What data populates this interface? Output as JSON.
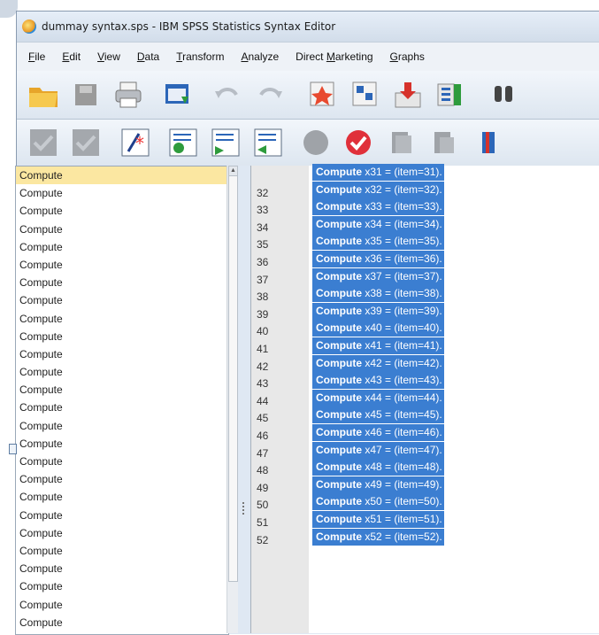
{
  "window": {
    "title": "dummay syntax.sps - IBM SPSS Statistics Syntax Editor"
  },
  "menu": [
    {
      "label": "File",
      "acc": "F",
      "rest": "ile"
    },
    {
      "label": "Edit",
      "acc": "E",
      "rest": "dit"
    },
    {
      "label": "View",
      "acc": "V",
      "rest": "iew"
    },
    {
      "label": "Data",
      "acc": "D",
      "rest": "ata"
    },
    {
      "label": "Transform",
      "acc": "T",
      "rest": "ransform"
    },
    {
      "label": "Analyze",
      "acc": "A",
      "rest": "nalyze"
    },
    {
      "label": "Direct Marketing",
      "pre": "Direct ",
      "acc": "M",
      "rest": "arketing"
    },
    {
      "label": "Graphs",
      "acc": "G",
      "rest": "raphs"
    }
  ],
  "toolbar1": [
    "open-folder-icon",
    "save-icon",
    "print-icon",
    "recall-dialog-icon",
    "undo-icon",
    "redo-icon",
    "goto-case-icon",
    "goto-variable-icon",
    "variables-icon",
    "run-descriptives-icon",
    "find-icon"
  ],
  "toolbar2": [
    "check-icon",
    "check-icon",
    "comment-icon",
    "run-icon",
    "run-to-end-icon",
    "run-selection-icon",
    "stop-icon",
    "validate-icon",
    "bookmark-icon",
    "bookmark-next-icon",
    "bookmark-previous-icon"
  ],
  "outline": {
    "selected_index": 0,
    "items": [
      "Compute",
      "Compute",
      "Compute",
      "Compute",
      "Compute",
      "Compute",
      "Compute",
      "Compute",
      "Compute",
      "Compute",
      "Compute",
      "Compute",
      "Compute",
      "Compute",
      "Compute",
      "Compute",
      "Compute",
      "Compute",
      "Compute",
      "Compute",
      "Compute",
      "Compute",
      "Compute",
      "Compute",
      "Compute",
      "Compute"
    ]
  },
  "editor": {
    "lines": [
      {
        "num": "",
        "kw": "Compute",
        "expr": " x31 = (item=31)."
      },
      {
        "num": "32",
        "kw": "Compute",
        "expr": " x32 = (item=32)."
      },
      {
        "num": "33",
        "kw": "Compute",
        "expr": " x33 = (item=33)."
      },
      {
        "num": "34",
        "kw": "Compute",
        "expr": " x34 = (item=34)."
      },
      {
        "num": "35",
        "kw": "Compute",
        "expr": " x35 = (item=35)."
      },
      {
        "num": "36",
        "kw": "Compute",
        "expr": " x36 = (item=36)."
      },
      {
        "num": "37",
        "kw": "Compute",
        "expr": " x37 = (item=37)."
      },
      {
        "num": "38",
        "kw": "Compute",
        "expr": " x38 = (item=38)."
      },
      {
        "num": "39",
        "kw": "Compute",
        "expr": " x39 = (item=39)."
      },
      {
        "num": "40",
        "kw": "Compute",
        "expr": " x40 = (item=40)."
      },
      {
        "num": "41",
        "kw": "Compute",
        "expr": " x41 = (item=41)."
      },
      {
        "num": "42",
        "kw": "Compute",
        "expr": " x42 = (item=42)."
      },
      {
        "num": "43",
        "kw": "Compute",
        "expr": " x43 = (item=43)."
      },
      {
        "num": "44",
        "kw": "Compute",
        "expr": " x44 = (item=44)."
      },
      {
        "num": "45",
        "kw": "Compute",
        "expr": " x45 = (item=45)."
      },
      {
        "num": "46",
        "kw": "Compute",
        "expr": " x46 = (item=46)."
      },
      {
        "num": "47",
        "kw": "Compute",
        "expr": " x47 = (item=47)."
      },
      {
        "num": "48",
        "kw": "Compute",
        "expr": " x48 = (item=48)."
      },
      {
        "num": "49",
        "kw": "Compute",
        "expr": " x49 = (item=49)."
      },
      {
        "num": "50",
        "kw": "Compute",
        "expr": " x50 = (item=50)."
      },
      {
        "num": "51",
        "kw": "Compute",
        "expr": " x51 = (item=51)."
      },
      {
        "num": "52",
        "kw": "Compute",
        "expr": " x52 = (item=52)."
      }
    ],
    "selection_color": "#3b7ed1"
  }
}
